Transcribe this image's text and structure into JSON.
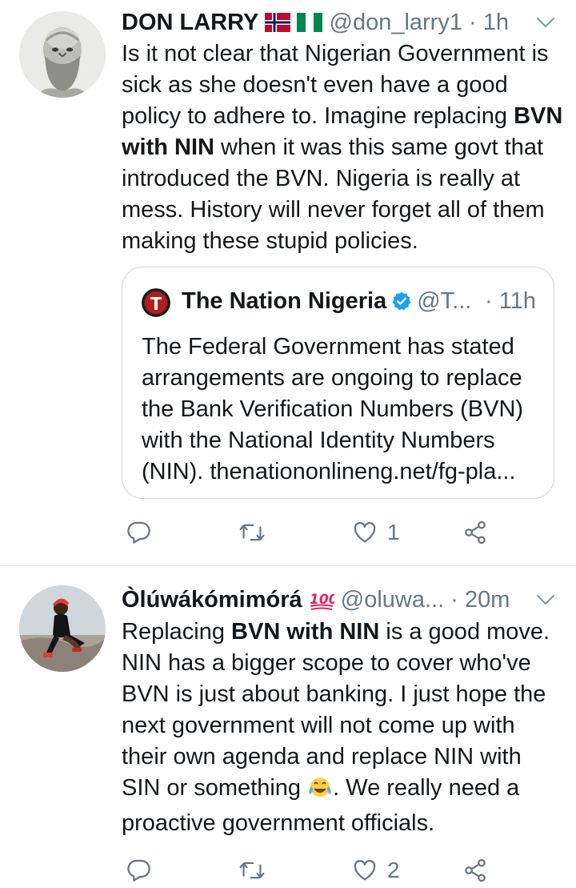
{
  "tweets": [
    {
      "name": "DON LARRY",
      "handle": "@don_larry1",
      "separator": "·",
      "time": "1h",
      "text_parts": [
        "Is it not clear that Nigerian Government is sick as she doesn't even have a good policy to adhere to. Imagine replacing ",
        "BVN with NIN",
        " when it was this same govt that introduced the BVN. Nigeria is really at mess. History will never forget all of them making these stupid policies."
      ],
      "quoted": {
        "name": "The Nation Nigeria",
        "handle": "@T...",
        "separator": "·",
        "time": "11h",
        "text": "The Federal Government has stated arrangements are ongoing to replace the Bank Verification Numbers (BVN) with the National Identity Numbers (NIN). thenationonlineng.net/fg-pla..."
      },
      "actions": {
        "reply_count": "",
        "retweet_count": "",
        "like_count": "1"
      }
    },
    {
      "name": "Òlúwákómimórá",
      "handle": "@oluwa...",
      "separator": "·",
      "time": "20m",
      "text_parts": [
        "Replacing ",
        "BVN with NIN",
        " is a good move. NIN has a bigger scope to cover who've BVN is just about banking. I just hope the next government will not come up with their own agenda and replace NIN with SIN or something ",
        ". We really need a proactive government officials."
      ],
      "actions": {
        "reply_count": "",
        "retweet_count": "",
        "like_count": "2"
      }
    }
  ],
  "icons": {
    "reply": "reply-icon",
    "retweet": "retweet-icon",
    "like": "heart-icon",
    "share": "share-icon",
    "more": "chevron-down-icon",
    "verified": "verified-badge-icon",
    "emoji_100": "hundred-points-emoji",
    "emoji_laugh": "tears-of-joy-emoji"
  },
  "colors": {
    "text": "#14171a",
    "muted": "#657786",
    "border": "#ccd6dd",
    "verified": "#1da1f2",
    "hundred": "#e0245e"
  }
}
